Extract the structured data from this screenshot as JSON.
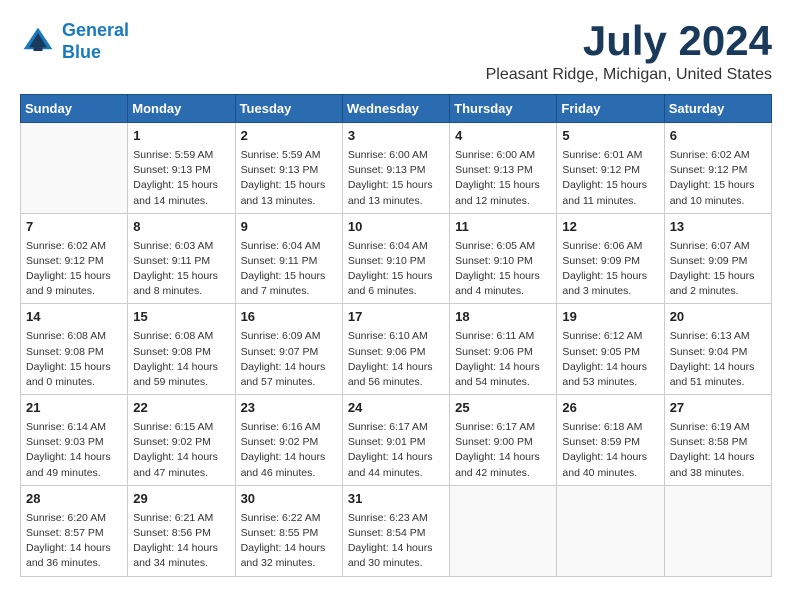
{
  "header": {
    "logo_line1": "General",
    "logo_line2": "Blue",
    "month_year": "July 2024",
    "location": "Pleasant Ridge, Michigan, United States"
  },
  "columns": [
    "Sunday",
    "Monday",
    "Tuesday",
    "Wednesday",
    "Thursday",
    "Friday",
    "Saturday"
  ],
  "weeks": [
    [
      {
        "day": "",
        "info": ""
      },
      {
        "day": "1",
        "info": "Sunrise: 5:59 AM\nSunset: 9:13 PM\nDaylight: 15 hours\nand 14 minutes."
      },
      {
        "day": "2",
        "info": "Sunrise: 5:59 AM\nSunset: 9:13 PM\nDaylight: 15 hours\nand 13 minutes."
      },
      {
        "day": "3",
        "info": "Sunrise: 6:00 AM\nSunset: 9:13 PM\nDaylight: 15 hours\nand 13 minutes."
      },
      {
        "day": "4",
        "info": "Sunrise: 6:00 AM\nSunset: 9:13 PM\nDaylight: 15 hours\nand 12 minutes."
      },
      {
        "day": "5",
        "info": "Sunrise: 6:01 AM\nSunset: 9:12 PM\nDaylight: 15 hours\nand 11 minutes."
      },
      {
        "day": "6",
        "info": "Sunrise: 6:02 AM\nSunset: 9:12 PM\nDaylight: 15 hours\nand 10 minutes."
      }
    ],
    [
      {
        "day": "7",
        "info": "Sunrise: 6:02 AM\nSunset: 9:12 PM\nDaylight: 15 hours\nand 9 minutes."
      },
      {
        "day": "8",
        "info": "Sunrise: 6:03 AM\nSunset: 9:11 PM\nDaylight: 15 hours\nand 8 minutes."
      },
      {
        "day": "9",
        "info": "Sunrise: 6:04 AM\nSunset: 9:11 PM\nDaylight: 15 hours\nand 7 minutes."
      },
      {
        "day": "10",
        "info": "Sunrise: 6:04 AM\nSunset: 9:10 PM\nDaylight: 15 hours\nand 6 minutes."
      },
      {
        "day": "11",
        "info": "Sunrise: 6:05 AM\nSunset: 9:10 PM\nDaylight: 15 hours\nand 4 minutes."
      },
      {
        "day": "12",
        "info": "Sunrise: 6:06 AM\nSunset: 9:09 PM\nDaylight: 15 hours\nand 3 minutes."
      },
      {
        "day": "13",
        "info": "Sunrise: 6:07 AM\nSunset: 9:09 PM\nDaylight: 15 hours\nand 2 minutes."
      }
    ],
    [
      {
        "day": "14",
        "info": "Sunrise: 6:08 AM\nSunset: 9:08 PM\nDaylight: 15 hours\nand 0 minutes."
      },
      {
        "day": "15",
        "info": "Sunrise: 6:08 AM\nSunset: 9:08 PM\nDaylight: 14 hours\nand 59 minutes."
      },
      {
        "day": "16",
        "info": "Sunrise: 6:09 AM\nSunset: 9:07 PM\nDaylight: 14 hours\nand 57 minutes."
      },
      {
        "day": "17",
        "info": "Sunrise: 6:10 AM\nSunset: 9:06 PM\nDaylight: 14 hours\nand 56 minutes."
      },
      {
        "day": "18",
        "info": "Sunrise: 6:11 AM\nSunset: 9:06 PM\nDaylight: 14 hours\nand 54 minutes."
      },
      {
        "day": "19",
        "info": "Sunrise: 6:12 AM\nSunset: 9:05 PM\nDaylight: 14 hours\nand 53 minutes."
      },
      {
        "day": "20",
        "info": "Sunrise: 6:13 AM\nSunset: 9:04 PM\nDaylight: 14 hours\nand 51 minutes."
      }
    ],
    [
      {
        "day": "21",
        "info": "Sunrise: 6:14 AM\nSunset: 9:03 PM\nDaylight: 14 hours\nand 49 minutes."
      },
      {
        "day": "22",
        "info": "Sunrise: 6:15 AM\nSunset: 9:02 PM\nDaylight: 14 hours\nand 47 minutes."
      },
      {
        "day": "23",
        "info": "Sunrise: 6:16 AM\nSunset: 9:02 PM\nDaylight: 14 hours\nand 46 minutes."
      },
      {
        "day": "24",
        "info": "Sunrise: 6:17 AM\nSunset: 9:01 PM\nDaylight: 14 hours\nand 44 minutes."
      },
      {
        "day": "25",
        "info": "Sunrise: 6:17 AM\nSunset: 9:00 PM\nDaylight: 14 hours\nand 42 minutes."
      },
      {
        "day": "26",
        "info": "Sunrise: 6:18 AM\nSunset: 8:59 PM\nDaylight: 14 hours\nand 40 minutes."
      },
      {
        "day": "27",
        "info": "Sunrise: 6:19 AM\nSunset: 8:58 PM\nDaylight: 14 hours\nand 38 minutes."
      }
    ],
    [
      {
        "day": "28",
        "info": "Sunrise: 6:20 AM\nSunset: 8:57 PM\nDaylight: 14 hours\nand 36 minutes."
      },
      {
        "day": "29",
        "info": "Sunrise: 6:21 AM\nSunset: 8:56 PM\nDaylight: 14 hours\nand 34 minutes."
      },
      {
        "day": "30",
        "info": "Sunrise: 6:22 AM\nSunset: 8:55 PM\nDaylight: 14 hours\nand 32 minutes."
      },
      {
        "day": "31",
        "info": "Sunrise: 6:23 AM\nSunset: 8:54 PM\nDaylight: 14 hours\nand 30 minutes."
      },
      {
        "day": "",
        "info": ""
      },
      {
        "day": "",
        "info": ""
      },
      {
        "day": "",
        "info": ""
      }
    ]
  ]
}
